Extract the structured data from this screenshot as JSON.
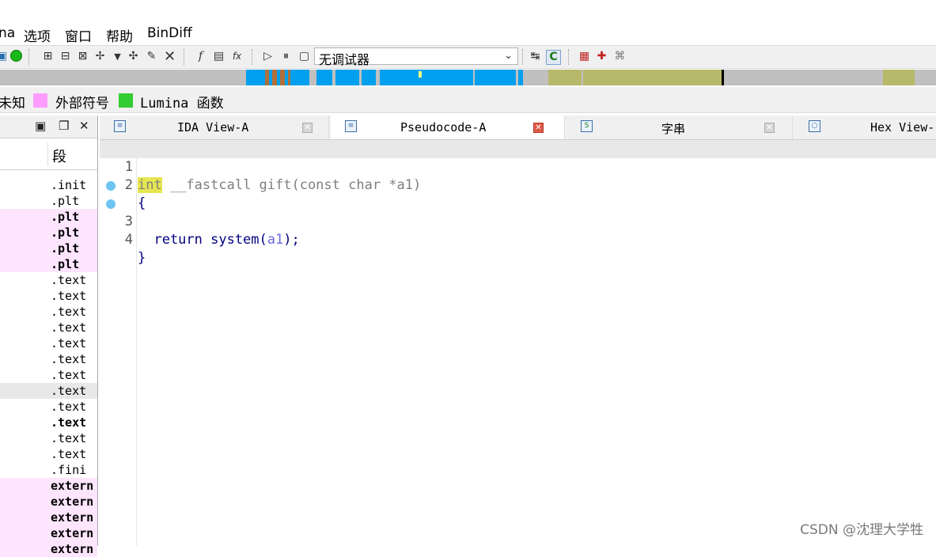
{
  "menu": [
    "na",
    "选项",
    "窗口",
    "帮助",
    "BinDiff"
  ],
  "toolbar": {
    "debugger_select": "无调试器",
    "icons": [
      "open-icon",
      "green-circle-icon",
      "xref-icon",
      "xref-icon",
      "new-struct-icon",
      "dropdown-icon",
      "new-enum-icon",
      "rename-icon",
      "delete-icon",
      "function-icon",
      "script-icon",
      "fx-icon",
      "play-icon",
      "pause-icon",
      "stop-icon",
      "attach-icon",
      "hex-rays-icon",
      "segment-icon",
      "breakpoint-icon",
      "tracing-icon"
    ]
  },
  "legend": {
    "unknown": "未知",
    "external": "外部符号",
    "lumina": "Lumina 函数",
    "colors": {
      "external": "#ff9cff",
      "lumina": "#33cc33"
    }
  },
  "left_pane": {
    "column_header": "段",
    "rows": [
      {
        "seg": ".init",
        "style": ""
      },
      {
        "seg": ".plt",
        "style": ""
      },
      {
        "seg": ".plt",
        "style": "pink bold"
      },
      {
        "seg": ".plt",
        "style": "pink bold"
      },
      {
        "seg": ".plt",
        "style": "pink bold"
      },
      {
        "seg": ".plt",
        "style": "pink bold"
      },
      {
        "seg": ".text",
        "style": ""
      },
      {
        "seg": ".text",
        "style": ""
      },
      {
        "seg": ".text",
        "style": ""
      },
      {
        "seg": ".text",
        "style": ""
      },
      {
        "seg": ".text",
        "style": ""
      },
      {
        "seg": ".text",
        "style": ""
      },
      {
        "seg": ".text",
        "style": ""
      },
      {
        "seg": ".text",
        "style": "sel"
      },
      {
        "seg": ".text",
        "style": ""
      },
      {
        "seg": ".text",
        "style": "bold"
      },
      {
        "seg": ".text",
        "style": ""
      },
      {
        "seg": ".text",
        "style": ""
      },
      {
        "seg": ".fini",
        "style": ""
      },
      {
        "seg": "extern",
        "style": "pink bold"
      },
      {
        "seg": "extern",
        "style": "pink bold"
      },
      {
        "seg": "extern",
        "style": "pink bold"
      },
      {
        "seg": "extern",
        "style": "pink bold"
      },
      {
        "seg": "extern",
        "style": "pink bold"
      }
    ]
  },
  "tabs": [
    {
      "label": "IDA View-A",
      "active": false
    },
    {
      "label": "Pseudocode-A",
      "active": true
    },
    {
      "label": "字串",
      "active": false
    },
    {
      "label": "Hex View-",
      "active": false
    }
  ],
  "code": {
    "line_numbers": [
      "1",
      "2",
      "3",
      "4"
    ],
    "line1": {
      "int": "int",
      "rest": " __fastcall gift(const char *a1)"
    },
    "line2": "{",
    "line3": {
      "ret": "  return system(",
      "arg": "a1",
      "tail": ");"
    },
    "line4": "}"
  },
  "watermark": "CSDN @沈理大学牲"
}
